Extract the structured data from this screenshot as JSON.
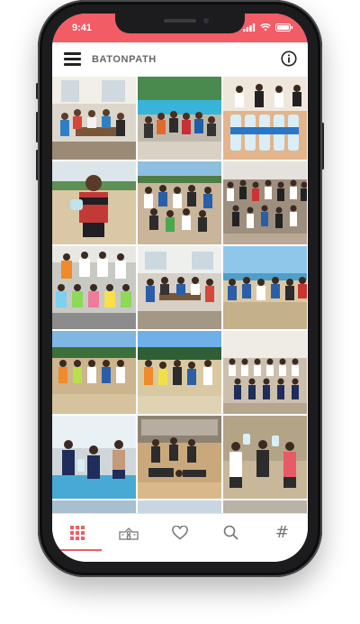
{
  "status": {
    "time": "9:41"
  },
  "app": {
    "title": "BATONPATH"
  },
  "colors": {
    "accent": "#f25c65",
    "icon_gray": "#777777"
  },
  "photos": [
    {
      "id": "photo-1",
      "scene": "indoor-team-table"
    },
    {
      "id": "photo-2",
      "scene": "poolside-team"
    },
    {
      "id": "photo-3",
      "scene": "stage-water-bottles"
    },
    {
      "id": "photo-4",
      "scene": "athlete-holding-bottle"
    },
    {
      "id": "photo-5",
      "scene": "field-group-bottles"
    },
    {
      "id": "photo-6",
      "scene": "gym-large-group"
    },
    {
      "id": "photo-7",
      "scene": "colorful-shirts-group"
    },
    {
      "id": "photo-8",
      "scene": "cafeteria-group"
    },
    {
      "id": "photo-9",
      "scene": "beach-group"
    },
    {
      "id": "photo-10",
      "scene": "field-lineup"
    },
    {
      "id": "photo-11",
      "scene": "track-group"
    },
    {
      "id": "photo-12",
      "scene": "indoor-uniform-group"
    },
    {
      "id": "photo-13",
      "scene": "pool-group"
    },
    {
      "id": "photo-14",
      "scene": "gym-group-posing"
    },
    {
      "id": "photo-15",
      "scene": "stone-wall-group"
    }
  ],
  "tabs": [
    {
      "icon": "grid-icon",
      "active": true
    },
    {
      "icon": "school-icon",
      "active": false
    },
    {
      "icon": "heart-icon",
      "active": false
    },
    {
      "icon": "search-icon",
      "active": false
    },
    {
      "icon": "hashtag-icon",
      "label": "#",
      "active": false
    }
  ]
}
